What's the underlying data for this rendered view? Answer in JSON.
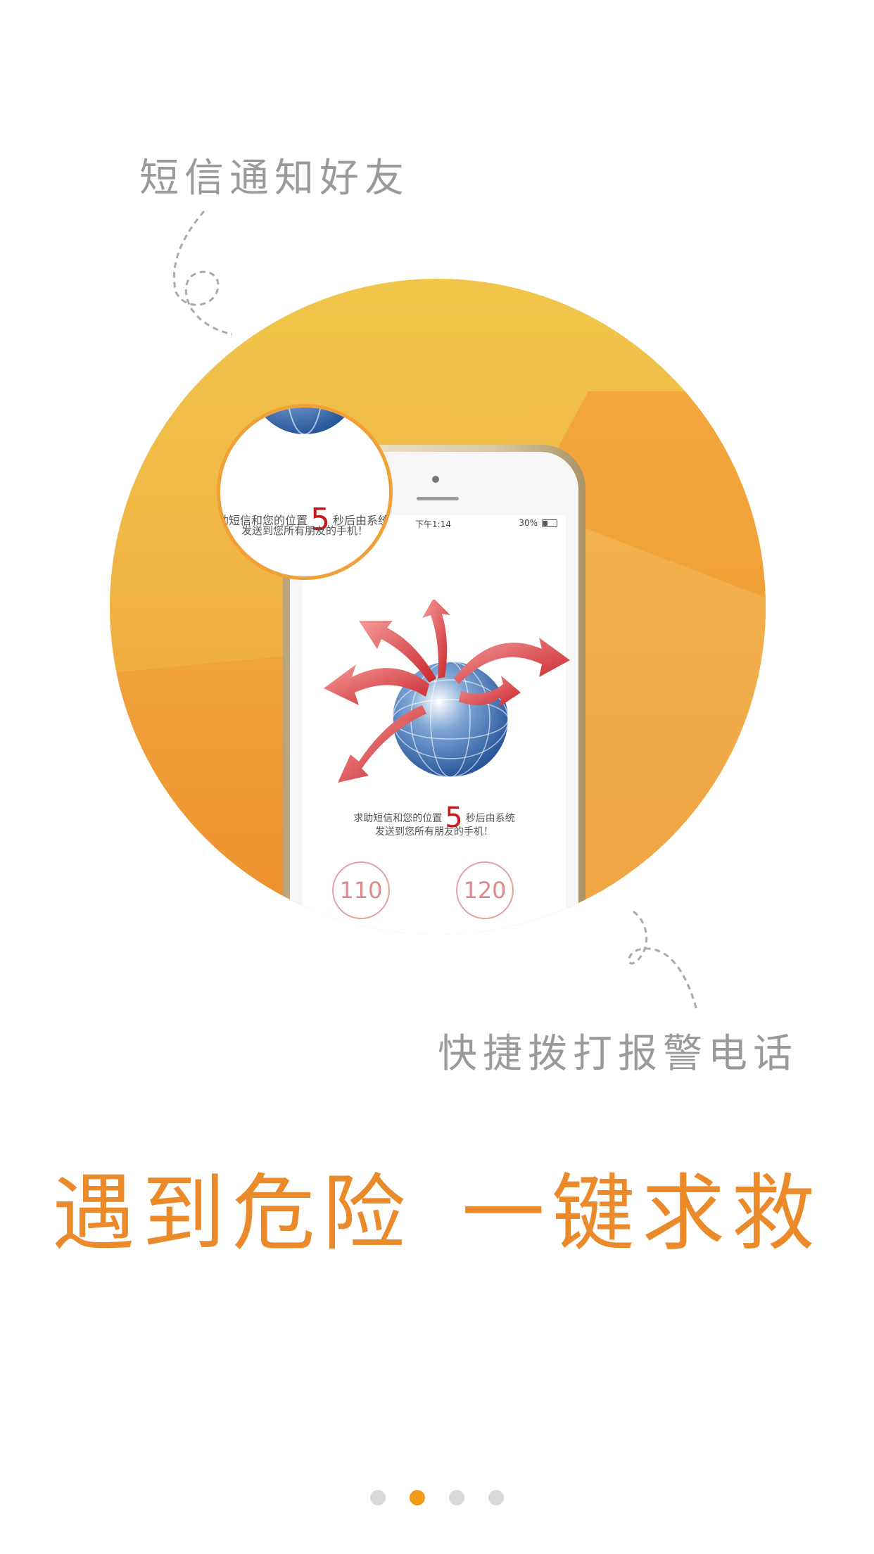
{
  "captions": {
    "top": "短信通知好友",
    "bottom": "快捷拨打报警电话"
  },
  "phone_screen": {
    "status_time": "下午1:14",
    "status_battery": "30%",
    "message_prefix": "求助短信和您的位置",
    "countdown": "5",
    "message_suffix": "秒后由系统",
    "message_line2": "发送到您所有朋友的手机！",
    "button_110": "110",
    "button_120": "120"
  },
  "magnifier": {
    "message_prefix": "求助短信和您的位置",
    "countdown": "5",
    "message_suffix": "秒后由系统",
    "message_line2": "发送到您所有朋友的手机！"
  },
  "headline": {
    "left": "遇到危险",
    "right": "一键求救"
  },
  "pager": {
    "count": 4,
    "active_index": 1
  },
  "colors": {
    "accent": "#ea8a2a",
    "active_dot": "#f29a1a",
    "inactive_dot": "#d9d9d9",
    "countdown_red": "#c8191e",
    "caption_gray": "#9a9a9a"
  }
}
